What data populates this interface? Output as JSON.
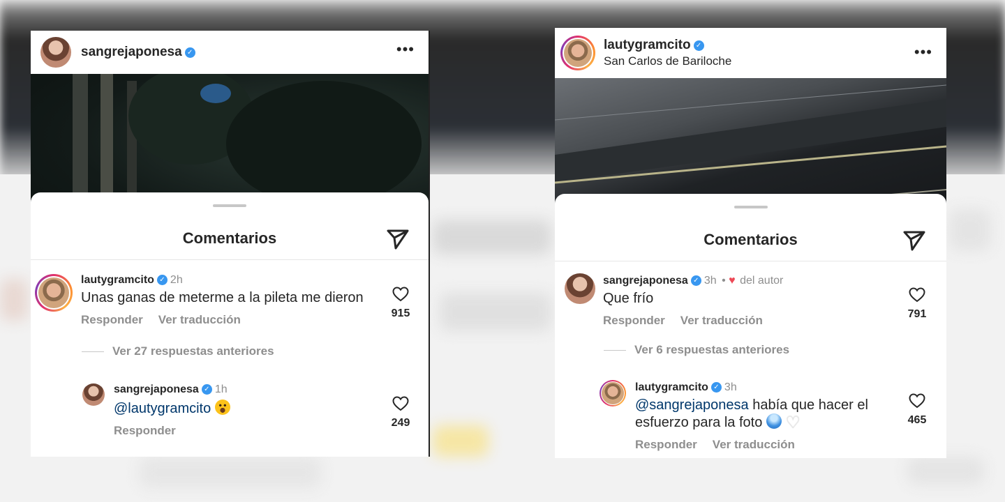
{
  "left_post": {
    "author": "sangrejaponesa",
    "sheet_title": "Comentarios",
    "comment": {
      "username": "lautygramcito",
      "time": "2h",
      "text": "Unas ganas de meterme a la pileta me dieron",
      "reply_label": "Responder",
      "translate_label": "Ver traducción",
      "likes": "915"
    },
    "view_replies": "Ver 27 respuestas anteriores",
    "reply": {
      "username": "sangrejaponesa",
      "time": "1h",
      "mention": "@lautygramcito",
      "emoji": "hushed-face-emoji",
      "reply_label": "Responder",
      "likes": "249"
    }
  },
  "right_post": {
    "author": "lautygramcito",
    "location": "San Carlos de Bariloche",
    "sheet_title": "Comentarios",
    "comment": {
      "username": "sangrejaponesa",
      "time": "3h",
      "separator": "•",
      "author_badge": "del autor",
      "text": "Que frío",
      "reply_label": "Responder",
      "translate_label": "Ver traducción",
      "likes": "791"
    },
    "view_replies": "Ver 6 respuestas anteriores",
    "reply": {
      "username": "lautygramcito",
      "time": "3h",
      "mention": "@sangrejaponesa",
      "text": " había que hacer el esfuerzo para la foto",
      "emojis": [
        "cold-face-emoji",
        "white-heart-emoji"
      ],
      "reply_label": "Responder",
      "translate_label": "Ver traducción",
      "likes": "465"
    }
  },
  "icons": {
    "verified": "✓",
    "more": "•••",
    "red_heart": "♥",
    "white_heart": "♡"
  },
  "colors": {
    "verified_blue": "#3897f0",
    "mention_blue": "#00376b",
    "secondary_text": "#8e8e8e",
    "heart_red": "#ed4956"
  }
}
